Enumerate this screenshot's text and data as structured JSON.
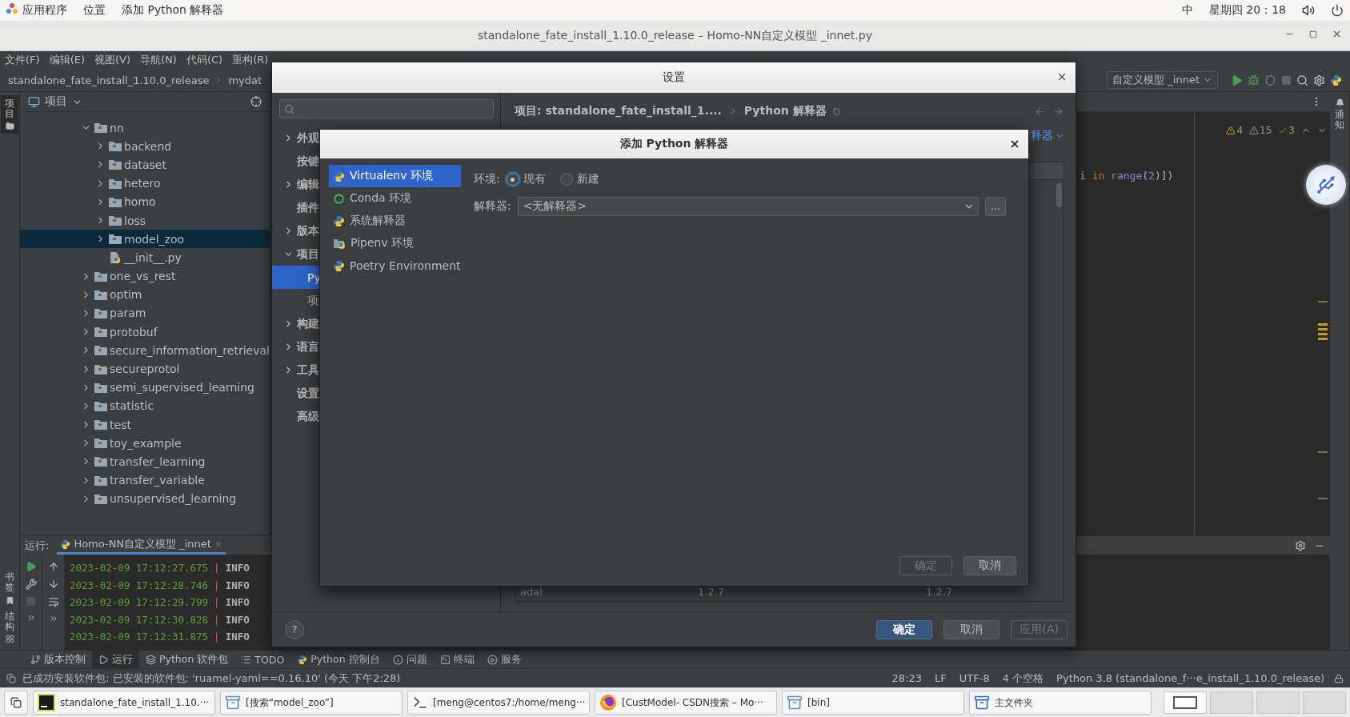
{
  "system_bar": {
    "menus": [
      "应用程序",
      "位置",
      "添加 Python 解释器"
    ],
    "input_method": "中",
    "clock": "星期四 20：18"
  },
  "window": {
    "title": "standalone_fate_install_1.10.0_release – Homo-NN自定义模型 _innet.py"
  },
  "menu_bar": [
    "文件(F)",
    "编辑(E)",
    "视图(V)",
    "导航(N)",
    "代码(C)",
    "重构(R)"
  ],
  "nav_bar": {
    "breadcrumbs": [
      "standalone_fate_install_1.10.0_release",
      "mydat"
    ],
    "run_config": "自定义模型 _innet"
  },
  "left_strip": {
    "top": [
      {
        "label": "项目",
        "selected": true
      }
    ],
    "bottom": [
      {
        "label": "书签",
        "selected": false
      },
      {
        "label": "结构",
        "selected": false
      }
    ]
  },
  "right_strip": {
    "label": "通知"
  },
  "project_panel": {
    "title": "项目",
    "tree": [
      {
        "name": "nn",
        "kind": "folder",
        "expanded": true,
        "selected": false,
        "children": [
          {
            "name": "backend",
            "kind": "folder",
            "expanded": false,
            "selected": false
          },
          {
            "name": "dataset",
            "kind": "folder",
            "expanded": false,
            "selected": false
          },
          {
            "name": "hetero",
            "kind": "folder",
            "expanded": false,
            "selected": false
          },
          {
            "name": "homo",
            "kind": "folder",
            "expanded": false,
            "selected": false
          },
          {
            "name": "loss",
            "kind": "folder",
            "expanded": false,
            "selected": false
          },
          {
            "name": "model_zoo",
            "kind": "folder",
            "expanded": false,
            "selected": true
          },
          {
            "name": "__init__.py",
            "kind": "file",
            "selected": false
          }
        ]
      },
      {
        "name": "one_vs_rest",
        "kind": "folder",
        "expanded": false,
        "selected": false
      },
      {
        "name": "optim",
        "kind": "folder",
        "expanded": false,
        "selected": false
      },
      {
        "name": "param",
        "kind": "folder",
        "expanded": false,
        "selected": false
      },
      {
        "name": "protobuf",
        "kind": "folder",
        "expanded": false,
        "selected": false
      },
      {
        "name": "secure_information_retrieval",
        "kind": "folder",
        "expanded": false,
        "selected": false
      },
      {
        "name": "secureprotol",
        "kind": "folder",
        "expanded": false,
        "selected": false
      },
      {
        "name": "semi_supervised_learning",
        "kind": "folder",
        "expanded": false,
        "selected": false
      },
      {
        "name": "statistic",
        "kind": "folder",
        "expanded": false,
        "selected": false
      },
      {
        "name": "test",
        "kind": "folder",
        "expanded": false,
        "selected": false
      },
      {
        "name": "toy_example",
        "kind": "folder",
        "expanded": false,
        "selected": false
      },
      {
        "name": "transfer_learning",
        "kind": "folder",
        "expanded": false,
        "selected": false
      },
      {
        "name": "transfer_variable",
        "kind": "folder",
        "expanded": false,
        "selected": false
      },
      {
        "name": "unsupervised_learning",
        "kind": "folder",
        "expanded": false,
        "selected": false
      }
    ]
  },
  "editor": {
    "inspections": [
      {
        "kind": "warning",
        "count": "4"
      },
      {
        "kind": "weak_warning",
        "count": "15"
      },
      {
        "kind": "ok",
        "count": "3"
      }
    ],
    "code": [
      {
        "text": "i",
        "kind": "plain",
        "gap_after": true
      },
      {
        "text": "in",
        "kind": "keyword",
        "gap_after": true
      },
      {
        "text": "range",
        "kind": "builtin",
        "gap_after": false
      },
      {
        "text": "(",
        "kind": "plain",
        "gap_after": false
      },
      {
        "text": "2",
        "kind": "number",
        "gap_after": false
      },
      {
        "text": ")])",
        "kind": "plain",
        "gap_after": false
      }
    ]
  },
  "run_panel": {
    "label": "运行:",
    "tab": "Homo-NN自定义模型 _innet",
    "log": [
      {
        "time": "2023-02-09 17:12:27.675",
        "sep": "|",
        "level": "INFO"
      },
      {
        "time": "2023-02-09 17:12:28.746",
        "sep": "|",
        "level": "INFO"
      },
      {
        "time": "2023-02-09 17:12:29.799",
        "sep": "|",
        "level": "INFO"
      },
      {
        "time": "2023-02-09 17:12:30.828",
        "sep": "|",
        "level": "INFO"
      },
      {
        "time": "2023-02-09 17:12:31.875",
        "sep": "|",
        "level": "INFO"
      }
    ]
  },
  "settings": {
    "title": "设置",
    "nav": [
      {
        "label": "外观",
        "kind": "group",
        "expanded": false,
        "selected": false
      },
      {
        "label": "按键",
        "kind": "leaf",
        "selected": false
      },
      {
        "label": "编辑",
        "kind": "group",
        "expanded": false,
        "selected": false
      },
      {
        "label": "插件",
        "kind": "leaf",
        "selected": false
      },
      {
        "label": "版本",
        "kind": "group",
        "expanded": false,
        "selected": false
      },
      {
        "label": "项目",
        "kind": "group",
        "expanded": true,
        "selected": false
      },
      {
        "label": "Py",
        "kind": "child",
        "selected": true
      },
      {
        "label": "项",
        "kind": "child",
        "selected": false
      },
      {
        "label": "构建",
        "kind": "group",
        "expanded": false,
        "selected": false
      },
      {
        "label": "语言",
        "kind": "group",
        "expanded": false,
        "selected": false
      },
      {
        "label": "工具",
        "kind": "group",
        "expanded": false,
        "selected": false
      },
      {
        "label": "设置",
        "kind": "leaf",
        "selected": false
      },
      {
        "label": "高级",
        "kind": "leaf",
        "selected": false
      }
    ],
    "breadcrumb": [
      "项目: standalone_fate_install_1....",
      "Python 解释器"
    ],
    "link": "释器",
    "table_rows": [
      [
        "adal",
        "1.2.7",
        "1.2.7"
      ]
    ],
    "help": "?",
    "buttons": [
      {
        "label": "确定",
        "kind": "primary"
      },
      {
        "label": "取消",
        "kind": "normal"
      },
      {
        "label": "应用(A)",
        "kind": "disabled"
      }
    ]
  },
  "add_dialog": {
    "title": "添加 Python 解释器",
    "types": [
      {
        "label": "Virtualenv 环境",
        "kind": "python",
        "selected": true
      },
      {
        "label": "Conda 环境",
        "kind": "conda",
        "selected": false
      },
      {
        "label": "系统解释器",
        "kind": "python",
        "selected": false
      },
      {
        "label": "Pipenv 环境",
        "kind": "pipenv",
        "selected": false
      },
      {
        "label": "Poetry Environment",
        "kind": "python",
        "selected": false
      }
    ],
    "env_label": "环境:",
    "radios": [
      {
        "label": "现有",
        "selected": true
      },
      {
        "label": "新建",
        "selected": false
      }
    ],
    "interpreter_label": "解释器:",
    "interpreter_value": "<无解释器>",
    "browse": "...",
    "buttons": [
      {
        "label": "确定",
        "disabled": true
      },
      {
        "label": "取消",
        "disabled": false
      }
    ]
  },
  "tool_tabs": [
    {
      "label": "版本控制",
      "kind": "vcs",
      "selected": false
    },
    {
      "label": "运行",
      "kind": "run",
      "selected": true
    },
    {
      "label": "Python 软件包",
      "kind": "packages",
      "selected": false
    },
    {
      "label": "TODO",
      "kind": "todo",
      "selected": false
    },
    {
      "label": "Python 控制台",
      "kind": "console",
      "selected": false
    },
    {
      "label": "问题",
      "kind": "problems",
      "selected": false
    },
    {
      "label": "终端",
      "kind": "terminal",
      "selected": false
    },
    {
      "label": "服务",
      "kind": "services",
      "selected": false
    }
  ],
  "status_bar": {
    "message": "已成功安装软件包: 已安装的软件包: 'ruamel-yaml==0.16.10' (今天 下午2:28)",
    "items": [
      "28:23",
      "LF",
      "UTF-8",
      "4 个空格",
      "Python 3.8 (standalone_f···e_install_1.10.0_release)"
    ]
  },
  "taskbar": {
    "items": [
      {
        "label": "standalone_fate_install_1.10.···",
        "kind": "ide"
      },
      {
        "label": "[搜索“model_zoo”]",
        "kind": "files"
      },
      {
        "label": "[meng@centos7:/home/meng···",
        "kind": "terminal"
      },
      {
        "label": "[CustModel- CSDN搜索 – Mo···",
        "kind": "browser"
      },
      {
        "label": "[bin]",
        "kind": "files"
      },
      {
        "label": "主文件夹",
        "kind": "folder"
      }
    ],
    "workspaces": [
      {
        "selected": true
      },
      {
        "selected": false
      },
      {
        "selected": false
      },
      {
        "selected": false
      }
    ]
  }
}
